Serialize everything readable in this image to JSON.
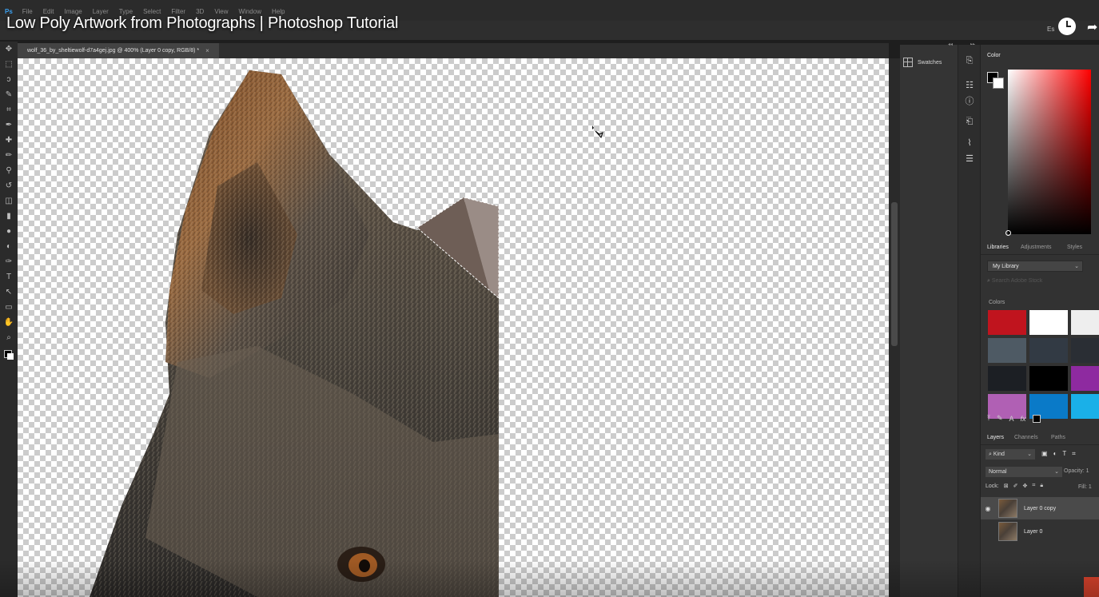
{
  "menu": {
    "app_logo": "Ps",
    "items": [
      "File",
      "Edit",
      "Image",
      "Layer",
      "Type",
      "Select",
      "Filter",
      "3D",
      "View",
      "Window",
      "Help"
    ]
  },
  "video": {
    "title": "Low Poly Artwork from Photographs | Photoshop Tutorial",
    "watch_later_icon": "clock-icon"
  },
  "workspace": {
    "label": "Es"
  },
  "document": {
    "tab_title": "wolf_36_by_sheltiewolf-d7a4gej.jpg @ 400% (Layer 0 copy, RGB/8) *",
    "close": "×"
  },
  "toolbar": {
    "tools": [
      "move-tool-icon",
      "marquee-tool-icon",
      "lasso-tool-icon",
      "quick-select-icon",
      "crop-tool-icon",
      "eyedropper-icon",
      "healing-brush-icon",
      "brush-tool-icon",
      "clone-stamp-icon",
      "history-brush-icon",
      "eraser-icon",
      "gradient-tool-icon",
      "blur-tool-icon",
      "dodge-tool-icon",
      "pen-tool-icon",
      "type-tool-icon",
      "path-select-icon",
      "shape-tool-icon",
      "hand-tool-icon",
      "zoom-tool-icon",
      "more-tools-icon"
    ],
    "glyphs": [
      "✥",
      "⬚",
      "ↄ",
      "✎",
      "⌗",
      "✒",
      "✚",
      "✏",
      "⚲",
      "↺",
      "◫",
      "▮",
      "●",
      "◐",
      "✑",
      "T",
      "↖",
      "▭",
      "✋",
      "⌕",
      "…"
    ]
  },
  "swatches_panel": {
    "label": "Swatches"
  },
  "color_panel": {
    "tab": "Color",
    "foreground": "#000000",
    "background": "#ffffff",
    "hue": "#ff0000"
  },
  "libraries": {
    "tabs": [
      "Libraries",
      "Adjustments",
      "Styles"
    ],
    "library_name": "My Library",
    "search_placeholder": "Search Adobe Stock",
    "colors_label": "Colors",
    "swatches": [
      "#c0141e",
      "#ffffff",
      "#eeeeee",
      "#4e5a64",
      "#323a44",
      "#2a2e34",
      "#1c1f24",
      "#000000",
      "#8e2aa0",
      "#b060b4",
      "#0a7ac8",
      "#1ab0e8"
    ]
  },
  "layers": {
    "tabs": [
      "Layers",
      "Channels",
      "Paths"
    ],
    "kind_filter": "Kind",
    "blend_mode": "Normal",
    "opacity_label": "Opacity: 1",
    "lock_label": "Lock:",
    "fill_label": "Fill: 1",
    "items": [
      {
        "name": "Layer 0 copy",
        "visible": true,
        "selected": true
      },
      {
        "name": "Layer 0",
        "visible": false,
        "selected": false
      }
    ]
  }
}
